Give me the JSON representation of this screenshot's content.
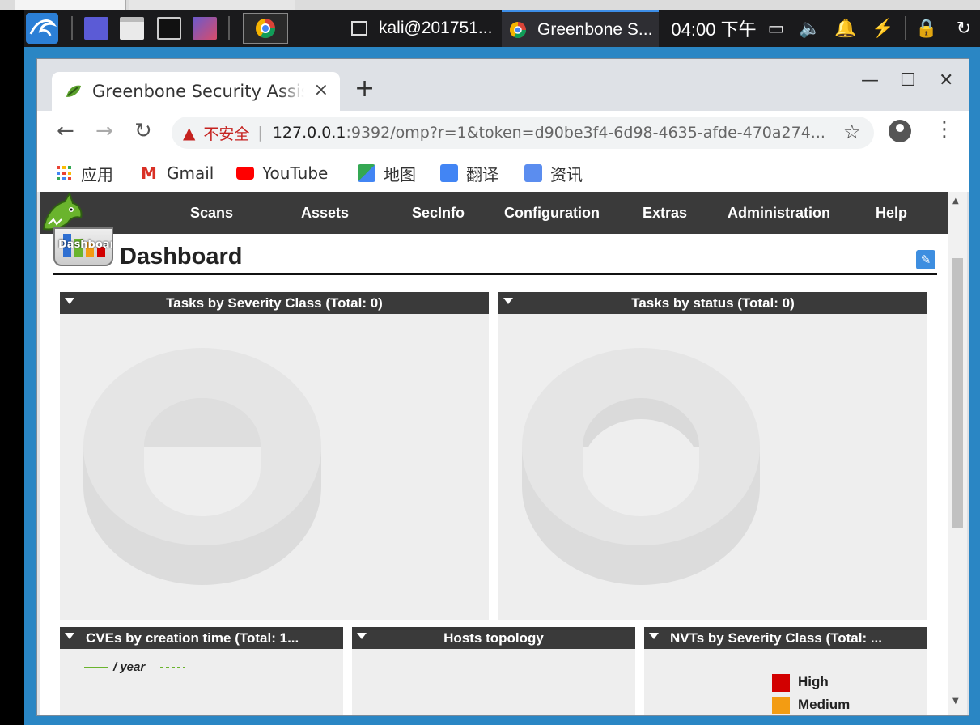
{
  "taskbar": {
    "tasks": [
      {
        "label": "kali@201751..."
      },
      {
        "label": "Greenbone S..."
      }
    ],
    "clock": "04:00 下午"
  },
  "browser": {
    "tab_title": "Greenbone Security Assistant",
    "tab_close": "×",
    "new_tab": "+",
    "insecure_label": "不安全",
    "url_host": "127.0.0.1",
    "url_path": ":9392/omp?r=1&token=d90be3f4-6d98-4635-afde-470a274...",
    "bookmarks": [
      {
        "label": "应用"
      },
      {
        "label": "Gmail"
      },
      {
        "label": "YouTube"
      },
      {
        "label": "地图"
      },
      {
        "label": "翻译"
      },
      {
        "label": "资讯"
      }
    ]
  },
  "gsa": {
    "nav": [
      "Scans",
      "Assets",
      "SecInfo",
      "Configuration",
      "Extras",
      "Administration",
      "Help"
    ],
    "dashboard_icon_label": "Dashboard",
    "page_title": "Dashboard",
    "panels": [
      {
        "title": "Tasks by Severity Class (Total: 0)"
      },
      {
        "title": "Tasks by status (Total: 0)"
      },
      {
        "title": "CVEs by creation time (Total: 1..."
      },
      {
        "title": "Hosts topology"
      },
      {
        "title": "NVTs by Severity Class (Total: ..."
      }
    ],
    "cve_legend": {
      "series_label": "/ year"
    },
    "nvt_legend": [
      {
        "label": "High",
        "color": "#d20000"
      },
      {
        "label": "Medium",
        "color": "#f39c12"
      }
    ]
  }
}
